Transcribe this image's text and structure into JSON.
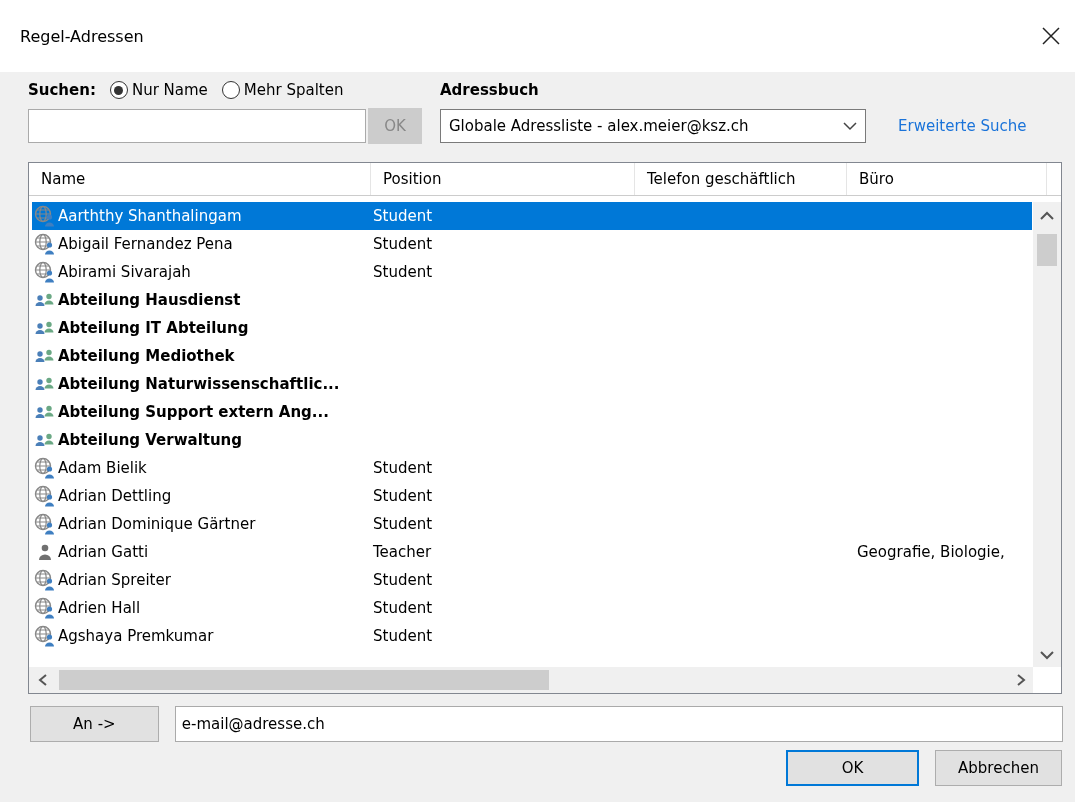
{
  "window": {
    "title": "Regel-Adressen"
  },
  "search": {
    "label": "Suchen:",
    "options": [
      {
        "label": "Nur Name",
        "selected": true
      },
      {
        "label": "Mehr Spalten",
        "selected": false
      }
    ],
    "ok_button": {
      "label": "OK",
      "disabled": true
    }
  },
  "address_book": {
    "label": "Adressbuch",
    "value": "Globale Adressliste - alex.meier@ksz.ch",
    "link": "Erweiterte Suche"
  },
  "table": {
    "columns": [
      "Name",
      "Position",
      "Telefon geschäftlich",
      "Büro"
    ],
    "rows": [
      {
        "kind": "user",
        "name": "Aarththy Shanthalingam",
        "position": "Student",
        "selected": true
      },
      {
        "kind": "user",
        "name": "Abigail Fernandez Pena",
        "position": "Student",
        "selected": false
      },
      {
        "kind": "user",
        "name": "Abirami Sivarajah",
        "position": "Student",
        "selected": false
      },
      {
        "kind": "group",
        "name": "Abteilung Hausdienst",
        "selected": false
      },
      {
        "kind": "group",
        "name": "Abteilung IT Abteilung",
        "selected": false
      },
      {
        "kind": "group",
        "name": "Abteilung Mediothek",
        "selected": false
      },
      {
        "kind": "group",
        "name": "Abteilung Naturwissenschaftlic...",
        "selected": false
      },
      {
        "kind": "group",
        "name": "Abteilung Support extern Ang...",
        "selected": false
      },
      {
        "kind": "group",
        "name": "Abteilung Verwaltung",
        "selected": false
      },
      {
        "kind": "user",
        "name": "Adam Bielik",
        "position": "Student",
        "selected": false
      },
      {
        "kind": "user",
        "name": "Adrian Dettling",
        "position": "Student",
        "selected": false
      },
      {
        "kind": "user",
        "name": "Adrian Dominique Gärtner",
        "position": "Student",
        "selected": false
      },
      {
        "kind": "person",
        "name": "Adrian Gatti",
        "position": "Teacher",
        "office": "Geografie, Biologie,",
        "selected": false
      },
      {
        "kind": "user",
        "name": "Adrian Spreiter",
        "position": "Student",
        "selected": false
      },
      {
        "kind": "user",
        "name": "Adrien Hall",
        "position": "Student",
        "selected": false
      },
      {
        "kind": "user",
        "name": "Agshaya Premkumar",
        "position": "Student",
        "selected": false
      }
    ]
  },
  "to_button": {
    "label": "An ->"
  },
  "to_field": {
    "value": "e-mail@adresse.ch"
  },
  "buttons": [
    {
      "label": "OK",
      "default": true
    },
    {
      "label": "Abbrechen",
      "default": false
    }
  ]
}
